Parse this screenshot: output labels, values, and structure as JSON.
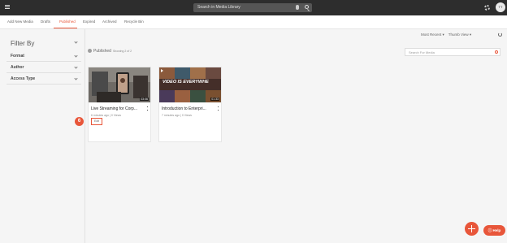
{
  "topbar": {
    "search_placeholder": "Search in Media Library",
    "avatar_initials": "TT"
  },
  "tabs": [
    {
      "label": "Add New Media"
    },
    {
      "label": "Drafts"
    },
    {
      "label": "Published"
    },
    {
      "label": "Expired"
    },
    {
      "label": "Archived"
    },
    {
      "label": "Recycle Bin"
    }
  ],
  "sidebar": {
    "title": "Filter By",
    "filters": [
      {
        "label": "Format"
      },
      {
        "label": "Author"
      },
      {
        "label": "Access Type"
      }
    ]
  },
  "toolbar": {
    "sort": "Most Recent",
    "view": "Thumb View"
  },
  "section": {
    "title": "Published",
    "count": "Showing 2 of 2",
    "search_placeholder": "Search For Media"
  },
  "cards": [
    {
      "title": "Live Streaming for Corp...",
      "meta": "6 minutes ago | 0 Views",
      "duration": "03:06",
      "edit_label": "Edit",
      "step": "6"
    },
    {
      "title": "Introduction to Enterpri...",
      "meta": "7 minutes ago | 0 Views",
      "duration": "01:33",
      "overlay": "VIDEO IS EVERYWHE"
    }
  ],
  "help_label": "Help"
}
